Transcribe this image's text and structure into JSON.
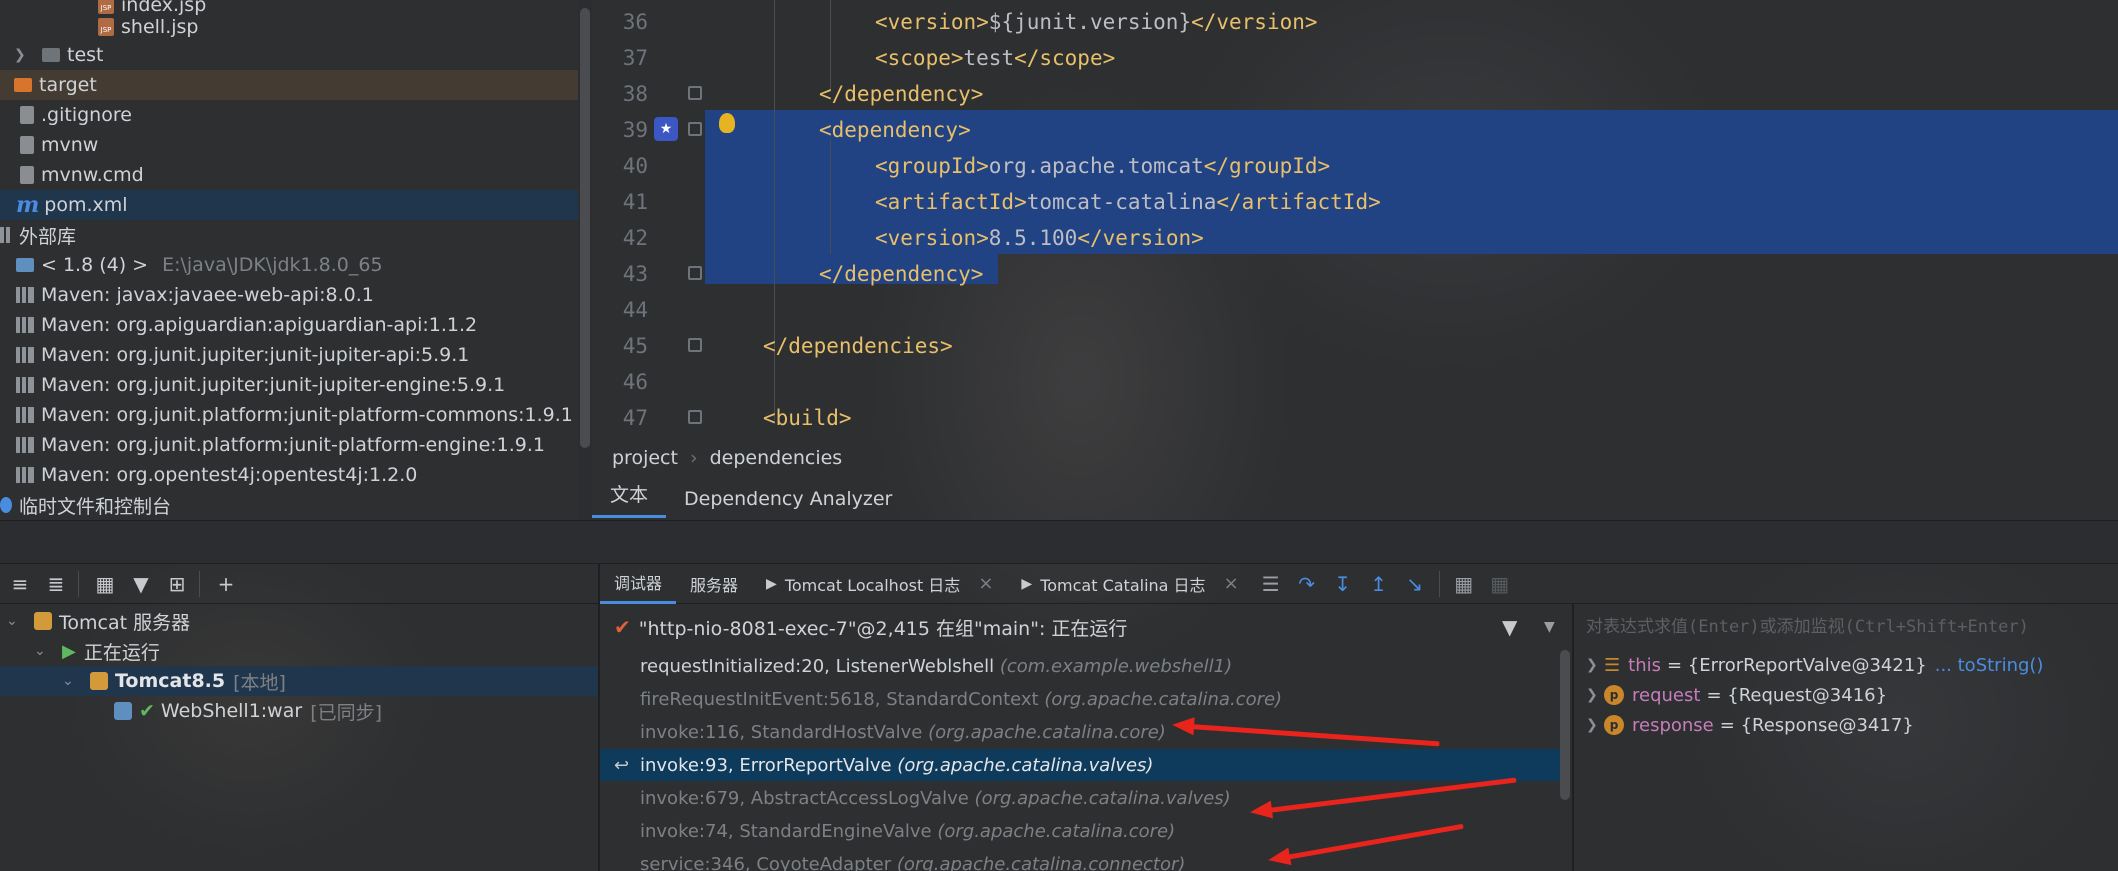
{
  "project_tree": {
    "items": [
      {
        "label": "index.jsp",
        "icon": "jsp-file-icon"
      },
      {
        "label": "shell.jsp",
        "icon": "jsp-file-icon"
      },
      {
        "label": "test",
        "icon": "folder-icon"
      },
      {
        "label": "target",
        "icon": "folder-icon"
      },
      {
        "label": ".gitignore",
        "icon": "file-icon"
      },
      {
        "label": "mvnw",
        "icon": "terminal-file-icon"
      },
      {
        "label": "mvnw.cmd",
        "icon": "file-icon"
      },
      {
        "label": "pom.xml",
        "icon": "maven-icon"
      },
      {
        "label": "外部库",
        "icon": "library-icon"
      },
      {
        "label": "< 1.8 (4) >",
        "detail": "E:\\java\\JDK\\jdk1.8.0_65",
        "icon": "jdk-icon"
      },
      {
        "label": "Maven: javax:javaee-web-api:8.0.1",
        "icon": "library-icon"
      },
      {
        "label": "Maven: org.apiguardian:apiguardian-api:1.1.2",
        "icon": "library-icon"
      },
      {
        "label": "Maven: org.junit.jupiter:junit-jupiter-api:5.9.1",
        "icon": "library-icon"
      },
      {
        "label": "Maven: org.junit.jupiter:junit-jupiter-engine:5.9.1",
        "icon": "library-icon"
      },
      {
        "label": "Maven: org.junit.platform:junit-platform-commons:1.9.1",
        "icon": "library-icon"
      },
      {
        "label": "Maven: org.junit.platform:junit-platform-engine:1.9.1",
        "icon": "library-icon"
      },
      {
        "label": "Maven: org.opentest4j:opentest4j:1.2.0",
        "icon": "library-icon"
      },
      {
        "label": "临时文件和控制台",
        "icon": "scratches-icon"
      }
    ]
  },
  "editor": {
    "lines": [
      {
        "num": "36",
        "pre": "<version>",
        "text": "${junit.version}",
        "post": "</version>"
      },
      {
        "num": "37",
        "pre": "<scope>",
        "text": "test",
        "post": "</scope>"
      },
      {
        "num": "38",
        "pre": "</dependency>",
        "text": "",
        "post": ""
      },
      {
        "num": "39",
        "pre": "<dependency>",
        "text": "",
        "post": ""
      },
      {
        "num": "40",
        "pre": "<groupId>",
        "text": "org.apache.tomcat",
        "post": "</groupId>"
      },
      {
        "num": "41",
        "pre": "<artifactId>",
        "text": "tomcat-catalina",
        "post": "</artifactId>"
      },
      {
        "num": "42",
        "pre": "<version>",
        "text": "8.5.100",
        "post": "</version>"
      },
      {
        "num": "43",
        "pre": "</dependency>",
        "text": "",
        "post": ""
      },
      {
        "num": "44",
        "pre": "",
        "text": "",
        "post": ""
      },
      {
        "num": "45",
        "pre": "</dependencies>",
        "text": "",
        "post": ""
      },
      {
        "num": "46",
        "pre": "",
        "text": "",
        "post": ""
      },
      {
        "num": "47",
        "pre": "<build>",
        "text": "",
        "post": ""
      }
    ],
    "breadcrumb": [
      "project",
      "dependencies"
    ],
    "tabs": [
      "文本",
      "Dependency Analyzer"
    ]
  },
  "services": {
    "tree": [
      {
        "label": "Tomcat 服务器",
        "icon": "tomcat-icon"
      },
      {
        "label": "正在运行",
        "icon": "run-icon"
      },
      {
        "label": "Tomcat8.5",
        "detail": "[本地]",
        "icon": "tomcat-icon"
      },
      {
        "label": "WebShell1:war",
        "detail": "[已同步]",
        "icon": "artifact-icon"
      }
    ]
  },
  "debugger": {
    "tabs": [
      "调试器",
      "服务器",
      "Tomcat Localhost 日志",
      "Tomcat Catalina 日志"
    ],
    "thread": "\"http-nio-8081-exec-7\"@2,415 在组\"main\": 正在运行",
    "watch_placeholder": "对表达式求值(Enter)或添加监视(Ctrl+Shift+Enter)",
    "frames": [
      {
        "method": "requestInitialized:20, ListenerWeblshell",
        "pkg": "(com.example.webshell1)"
      },
      {
        "method": "fireRequestInitEvent:5618, StandardContext",
        "pkg": "(org.apache.catalina.core)"
      },
      {
        "method": "invoke:116, StandardHostValve",
        "pkg": "(org.apache.catalina.core)"
      },
      {
        "method": "invoke:93, ErrorReportValve",
        "pkg": "(org.apache.catalina.valves)"
      },
      {
        "method": "invoke:679, AbstractAccessLogValve",
        "pkg": "(org.apache.catalina.valves)"
      },
      {
        "method": "invoke:74, StandardEngineValve",
        "pkg": "(org.apache.catalina.core)"
      },
      {
        "method": "service:346, CoyoteAdapter",
        "pkg": "(org.apache.catalina.connector)"
      }
    ],
    "variables": [
      {
        "name": "this",
        "value": "= {ErrorReportValve@3421}",
        "extra": "... toString()"
      },
      {
        "name": "request",
        "value": "= {Request@3416}",
        "extra": ""
      },
      {
        "name": "response",
        "value": "= {Response@3417}",
        "extra": ""
      }
    ]
  },
  "colors": {
    "accent": "#4a8de0",
    "selection": "#214283",
    "tag": "#e8bf6a",
    "annotation_arrow": "#e8241c"
  }
}
